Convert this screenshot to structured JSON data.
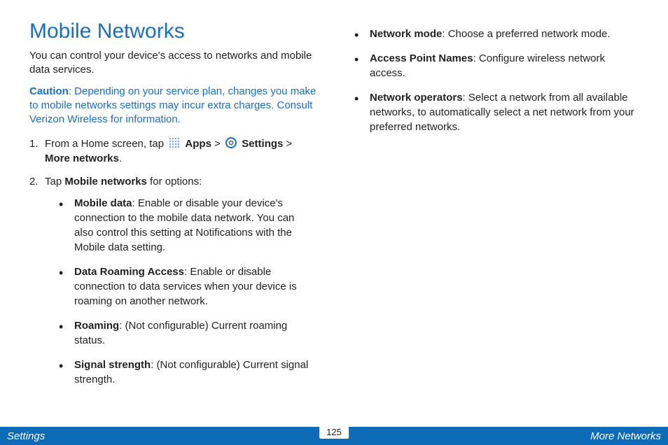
{
  "title": "Mobile Networks",
  "intro": "You can control your device's access to networks and mobile data services.",
  "caution_label": "Caution",
  "caution_text": ": Depending on your service plan, changes you make to mobile networks settings may incur extra charges. Consult Verizon Wireless for information.",
  "step1_a": "From a Home screen, tap ",
  "step1_apps": "Apps",
  "step1_gt1": " > ",
  "step1_settings": "Settings",
  "step1_gt2": " > ",
  "step1_more": "More networks",
  "step1_dot": ".",
  "step2_a": "Tap ",
  "step2_b": "Mobile networks",
  "step2_c": " for options:",
  "bullets_left": [
    {
      "term": "Mobile data",
      "desc": ": Enable or disable your device's connection to the mobile data network. You can also control this setting at Notifications with the Mobile data setting."
    },
    {
      "term": "Data Roaming Access",
      "desc": ": Enable or disable connection to data services when your device is roaming on another network."
    },
    {
      "term": "Roaming",
      "desc": ": (Not configurable) Current roaming status."
    },
    {
      "term": "Signal strength",
      "desc": ": (Not configurable) Current signal strength."
    }
  ],
  "bullets_right": [
    {
      "term": "Network mode",
      "desc": ": Choose a preferred network mode."
    },
    {
      "term": "Access Point Names",
      "desc": ": Configure wireless network access."
    },
    {
      "term": "Network operators",
      "desc": ": Select a network from all available networks, to automatically select a net network from your preferred networks."
    }
  ],
  "footer_left": "Settings",
  "footer_page": "125",
  "footer_right": "More Networks"
}
